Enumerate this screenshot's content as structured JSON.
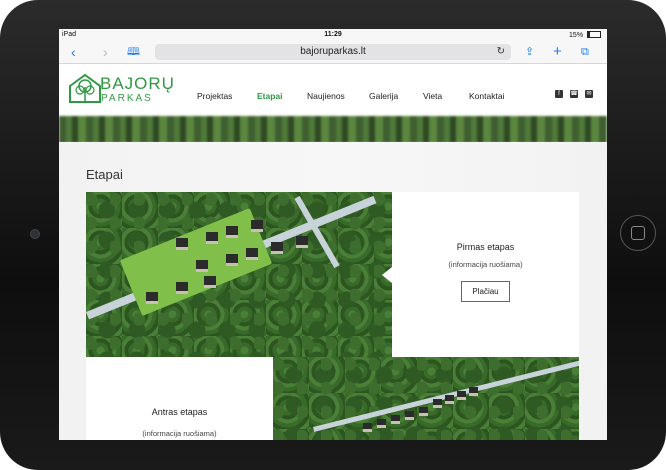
{
  "status": {
    "device": "iPad",
    "time": "11:29",
    "battery": "15%"
  },
  "browser": {
    "url": "bajoruparkas.lt"
  },
  "logo": {
    "line1": "BAJORŲ",
    "line2": "PARKAS"
  },
  "nav": [
    "Projektas",
    "Etapai",
    "Naujienos",
    "Galerija",
    "Vieta",
    "Kontaktai"
  ],
  "nav_active": "Etapai",
  "social": [
    "facebook-icon",
    "phone-icon",
    "mail-icon"
  ],
  "page": {
    "title": "Etapai"
  },
  "stages": [
    {
      "title": "Pirmas etapas",
      "subtitle": "(informacija ruošiama)",
      "button": "Plačiau"
    },
    {
      "title": "Antras etapas",
      "subtitle": "(informacija ruošiama)"
    }
  ],
  "colors": {
    "brand_green": "#2e9a43"
  }
}
